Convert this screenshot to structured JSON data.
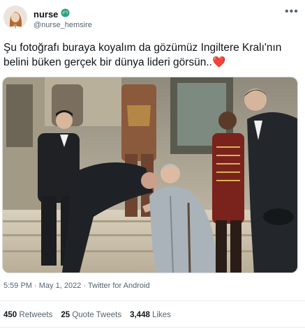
{
  "author": {
    "display_name": "nurse",
    "handle": "@nurse_hemsire",
    "badge_icon": "globe-icon"
  },
  "menu_icon": "more-icon",
  "menu_glyph": "•••",
  "tweet": {
    "text": "Şu fotoğrafı buraya koyalım da gözümüz Ingiltere Kralı'nın belini büken gerçek bir dünya lideri görsün..",
    "emoji": "❤️"
  },
  "meta": {
    "time": "5:59 PM",
    "date": "May 1, 2022",
    "source": "Twitter for Android",
    "separator": "·"
  },
  "stats": {
    "retweets_count": "450",
    "retweets_label": "Retweets",
    "quotes_count": "25",
    "quotes_label": "Quote Tweets",
    "likes_count": "3,448",
    "likes_label": "Likes"
  },
  "colors": {
    "text": "#0f1419",
    "secondary": "#536471",
    "heart": "#e0245e"
  }
}
